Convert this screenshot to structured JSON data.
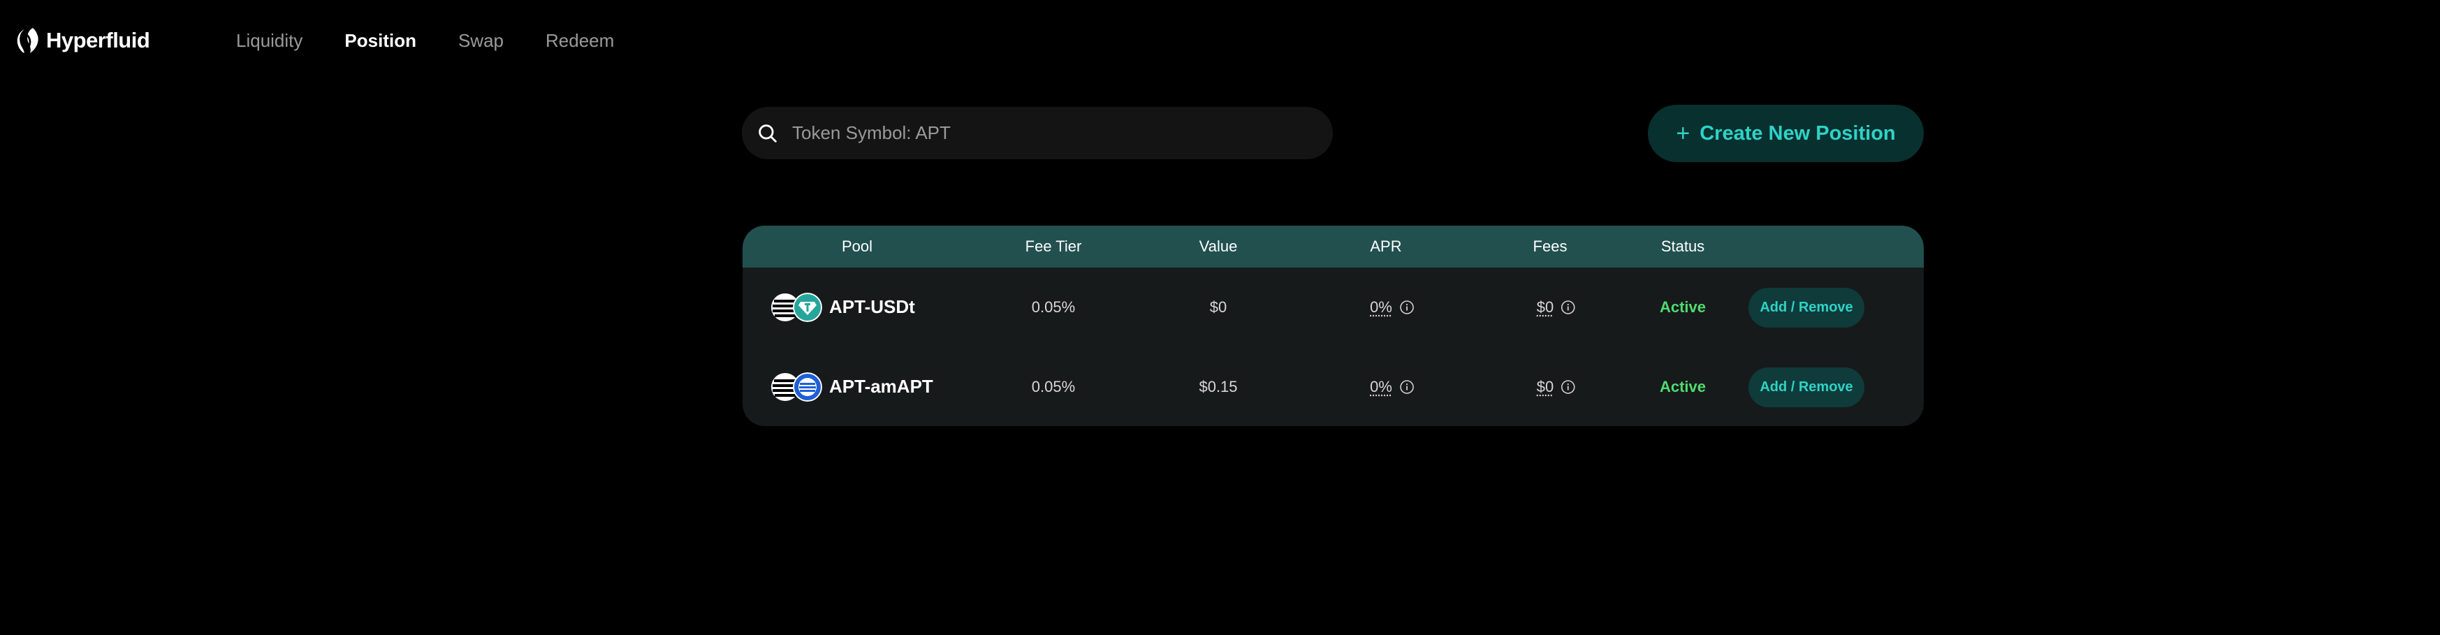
{
  "brand": {
    "name": "Hyperfluid"
  },
  "nav": {
    "items": [
      {
        "label": "Liquidity",
        "active": false
      },
      {
        "label": "Position",
        "active": true
      },
      {
        "label": "Swap",
        "active": false
      },
      {
        "label": "Redeem",
        "active": false
      }
    ]
  },
  "search": {
    "placeholder": "Token Symbol: APT",
    "icon": "search-icon"
  },
  "create_button": {
    "label": "Create New Position",
    "icon": "plus-icon"
  },
  "table": {
    "headers": [
      "Pool",
      "Fee Tier",
      "Value",
      "APR",
      "Fees",
      "Status"
    ],
    "rows": [
      {
        "pool": "APT-USDt",
        "fee_tier": "0.05%",
        "value": "$0",
        "apr": "0%",
        "fees": "$0",
        "status": "Active",
        "action": "Add / Remove"
      },
      {
        "pool": "APT-amAPT",
        "fee_tier": "0.05%",
        "value": "$0.15",
        "apr": "0%",
        "fees": "$0",
        "status": "Active",
        "action": "Add / Remove"
      }
    ]
  },
  "colors": {
    "accent": "#2ed3c6",
    "header_bg": "#21504f",
    "status_active": "#4fdb6f",
    "button_bg": "#08302f"
  }
}
